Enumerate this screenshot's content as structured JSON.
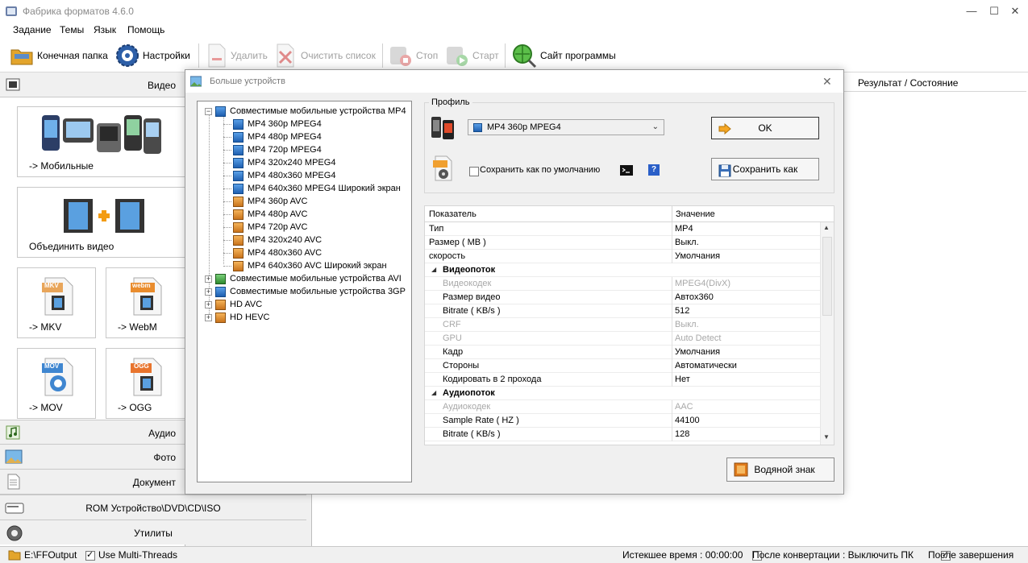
{
  "window": {
    "title": "Фабрика форматов 4.6.0",
    "controls": {
      "minimize": "—",
      "maximize": "☐",
      "close": "✕"
    }
  },
  "menu": [
    "Задание",
    "Темы",
    "Язык",
    "Помощь"
  ],
  "toolbar": {
    "output_folder": "Конечная папка",
    "settings": "Настройки",
    "delete": "Удалить",
    "clear_list": "Очистить список",
    "stop": "Стоп",
    "start": "Старт",
    "website": "Сайт программы"
  },
  "left_panel": {
    "video_header": "Видео",
    "tiles": {
      "mobile": "-> Мобильные",
      "join": "Объединить видео",
      "mkv": "-> MKV",
      "mkv_badge": "MKV",
      "webm": "-> WebM",
      "webm_badge": "webm",
      "mov": "-> MOV",
      "mov_badge": "MOV",
      "ogg": "-> OGG",
      "ogg_badge": "OGG"
    },
    "audio": "Аудио",
    "photo": "Фото",
    "document": "Документ",
    "rom": "ROM Устройство\\DVD\\CD\\ISO",
    "utilities": "Утилиты"
  },
  "main": {
    "column_header": "Результат / Состояние"
  },
  "statusbar": {
    "output_path": "E:\\FFOutput",
    "multithreads": "Use Multi-Threads",
    "multithreads_checked": true,
    "elapsed": "Истекшее время : 00:00:00",
    "after_convert": "После конвертации : Выключить ПК",
    "after_convert_checked": false,
    "after_finish": "После завершения",
    "after_finish_checked": true
  },
  "dialog": {
    "title": "Больше устройств",
    "close": "✕",
    "tree": {
      "mp4_group": "Совместимые мобильные устройства MP4",
      "mp4_items": [
        {
          "label": "MP4 360p MPEG4",
          "icon": "blue"
        },
        {
          "label": "MP4 480p MPEG4",
          "icon": "blue"
        },
        {
          "label": "MP4 720p MPEG4",
          "icon": "blue"
        },
        {
          "label": "MP4 320x240 MPEG4",
          "icon": "blue"
        },
        {
          "label": "MP4 480x360 MPEG4",
          "icon": "blue"
        },
        {
          "label": "MP4 640x360 MPEG4 Широкий экран",
          "icon": "blue"
        },
        {
          "label": "MP4 360p AVC",
          "icon": "orange"
        },
        {
          "label": "MP4 480p AVC",
          "icon": "orange"
        },
        {
          "label": "MP4 720p AVC",
          "icon": "orange"
        },
        {
          "label": "MP4 320x240 AVC",
          "icon": "orange"
        },
        {
          "label": "MP4 480x360 AVC",
          "icon": "orange"
        },
        {
          "label": "MP4 640x360 AVC Широкий экран",
          "icon": "orange"
        }
      ],
      "groups": [
        {
          "label": "Совместимые мобильные устройства AVI",
          "icon": "green"
        },
        {
          "label": "Совместимые мобильные устройства 3GP",
          "icon": "blue"
        },
        {
          "label": "HD AVC",
          "icon": "orange"
        },
        {
          "label": "HD HEVC",
          "icon": "orange"
        }
      ]
    },
    "profile": {
      "label": "Профиль",
      "selected": "MP4 360p MPEG4",
      "save_default": "Сохранить как по умолчанию",
      "save_default_checked": false,
      "help": "?",
      "ok": "OK",
      "save_as": "Сохранить как"
    },
    "grid": {
      "col_param": "Показатель",
      "col_value": "Значение",
      "rows": [
        {
          "k": "Тип",
          "v": "MP4",
          "type": "normal",
          "indent": false
        },
        {
          "k": "Размер ( MB )",
          "v": "Выкл.",
          "type": "normal",
          "indent": false
        },
        {
          "k": "скорость",
          "v": "Умолчания",
          "type": "normal",
          "indent": false
        },
        {
          "k": "Видеопоток",
          "v": "",
          "type": "group",
          "indent": true
        },
        {
          "k": "Видеокодек",
          "v": "MPEG4(DivX)",
          "type": "dis",
          "indent": true
        },
        {
          "k": "Размер видео",
          "v": "Автоx360",
          "type": "normal",
          "indent": true
        },
        {
          "k": "Bitrate ( KB/s )",
          "v": "512",
          "type": "normal",
          "indent": true
        },
        {
          "k": "CRF",
          "v": "Выкл.",
          "type": "dis",
          "indent": true
        },
        {
          "k": "GPU",
          "v": "Auto Detect",
          "type": "dis",
          "indent": true
        },
        {
          "k": "Кадр",
          "v": "Умолчания",
          "type": "normal",
          "indent": true
        },
        {
          "k": "Стороны",
          "v": "Автоматически",
          "type": "normal",
          "indent": true
        },
        {
          "k": "Кодировать в 2 прохода",
          "v": "Нет",
          "type": "normal",
          "indent": true
        },
        {
          "k": "Аудиопоток",
          "v": "",
          "type": "group",
          "indent": true
        },
        {
          "k": "Аудиокодек",
          "v": "AAC",
          "type": "dis",
          "indent": true
        },
        {
          "k": "Sample Rate ( HZ )",
          "v": "44100",
          "type": "normal",
          "indent": true
        },
        {
          "k": "Bitrate ( KB/s )",
          "v": "128",
          "type": "normal",
          "indent": true
        }
      ]
    },
    "watermark": "Водяной знак"
  }
}
